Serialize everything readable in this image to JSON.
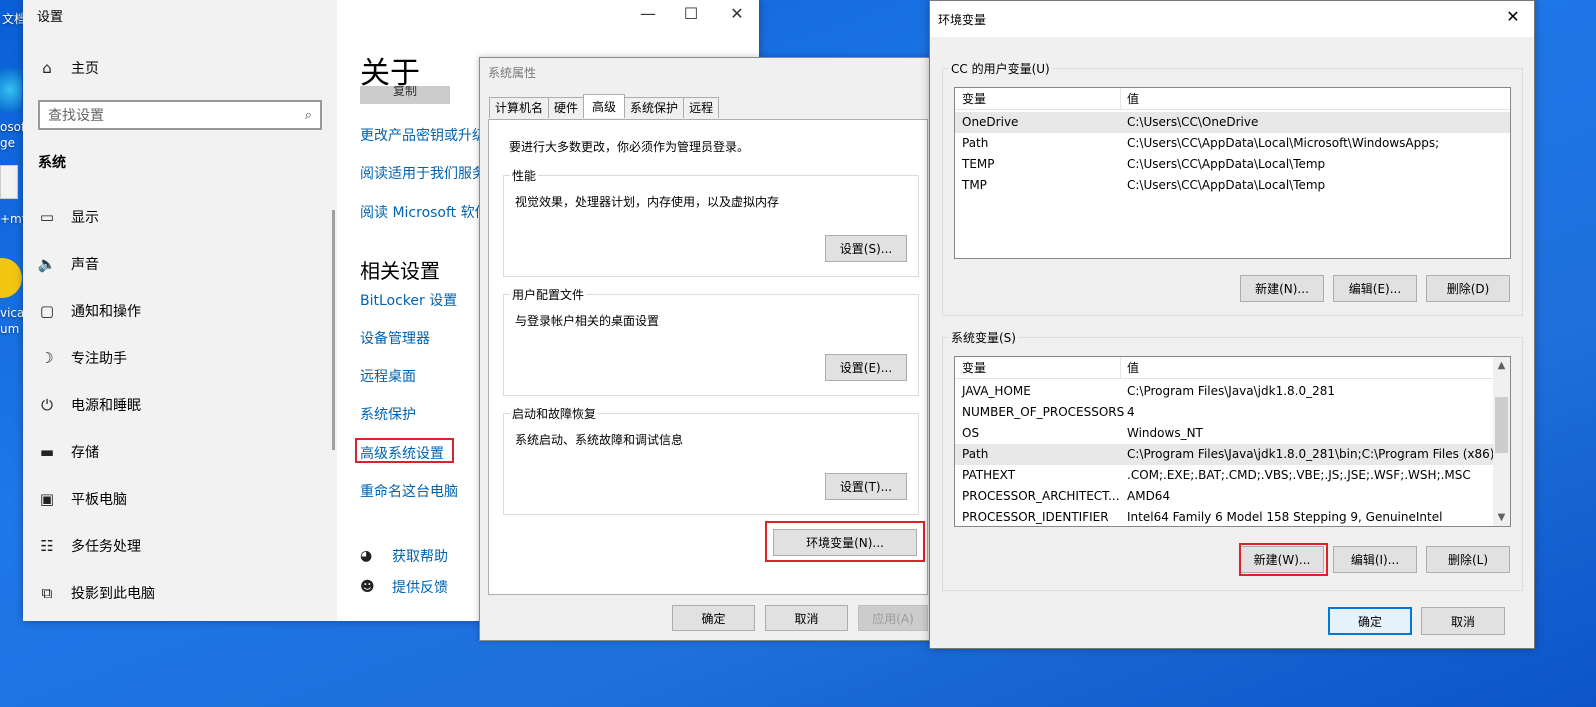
{
  "desktop": {
    "fragments": [
      "文档",
      "osoft",
      "ge",
      "+my",
      "vicat",
      "um"
    ]
  },
  "settings": {
    "window_title": "设置",
    "controls": {
      "minimize": "—",
      "maximize": "☐",
      "close": "✕"
    },
    "home": "主页",
    "search_placeholder": "查找设置",
    "section": "系统",
    "nav": [
      {
        "label": "显示",
        "icon": "monitor-icon"
      },
      {
        "label": "声音",
        "icon": "speaker-icon"
      },
      {
        "label": "通知和操作",
        "icon": "notification-icon"
      },
      {
        "label": "专注助手",
        "icon": "moon-icon"
      },
      {
        "label": "电源和睡眠",
        "icon": "power-icon"
      },
      {
        "label": "存储",
        "icon": "storage-icon"
      },
      {
        "label": "平板电脑",
        "icon": "tablet-icon"
      },
      {
        "label": "多任务处理",
        "icon": "multitask-icon"
      },
      {
        "label": "投影到此电脑",
        "icon": "project-icon"
      }
    ],
    "about_title": "关于",
    "copy_button": "复制",
    "about_links": [
      "更改产品密钥或升级",
      "阅读适用于我们服务",
      "阅读 Microsoft 软件"
    ],
    "related_title": "相关设置",
    "related_links": [
      "BitLocker 设置",
      "设备管理器",
      "远程桌面",
      "系统保护",
      "高级系统设置",
      "重命名这台电脑"
    ],
    "help": "获取帮助",
    "feedback": "提供反馈"
  },
  "sysprop": {
    "title": "系统属性",
    "tabs": [
      "计算机名",
      "硬件",
      "高级",
      "系统保护",
      "远程"
    ],
    "active_tab": "高级",
    "admin_note": "要进行大多数更改，你必须作为管理员登录。",
    "groups": [
      {
        "label": "性能",
        "desc": "视觉效果，处理器计划，内存使用，以及虚拟内存",
        "button": "设置(S)..."
      },
      {
        "label": "用户配置文件",
        "desc": "与登录帐户相关的桌面设置",
        "button": "设置(E)..."
      },
      {
        "label": "启动和故障恢复",
        "desc": "系统启动、系统故障和调试信息",
        "button": "设置(T)..."
      }
    ],
    "env_button": "环境变量(N)...",
    "ok": "确定",
    "cancel": "取消",
    "apply": "应用(A)"
  },
  "envvars": {
    "title": "环境变量",
    "close": "✕",
    "user_section": "CC 的用户变量(U)",
    "col_var": "变量",
    "col_val": "值",
    "user_rows": [
      {
        "name": "OneDrive",
        "value": "C:\\Users\\CC\\OneDrive"
      },
      {
        "name": "Path",
        "value": "C:\\Users\\CC\\AppData\\Local\\Microsoft\\WindowsApps;"
      },
      {
        "name": "TEMP",
        "value": "C:\\Users\\CC\\AppData\\Local\\Temp"
      },
      {
        "name": "TMP",
        "value": "C:\\Users\\CC\\AppData\\Local\\Temp"
      }
    ],
    "user_buttons": {
      "new": "新建(N)...",
      "edit": "编辑(E)...",
      "delete": "删除(D)"
    },
    "system_section": "系统变量(S)",
    "system_rows": [
      {
        "name": "JAVA_HOME",
        "value": "C:\\Program Files\\Java\\jdk1.8.0_281"
      },
      {
        "name": "NUMBER_OF_PROCESSORS",
        "value": "4"
      },
      {
        "name": "OS",
        "value": "Windows_NT"
      },
      {
        "name": "Path",
        "value": "C:\\Program Files\\Java\\jdk1.8.0_281\\bin;C:\\Program Files (x86)..."
      },
      {
        "name": "PATHEXT",
        "value": ".COM;.EXE;.BAT;.CMD;.VBS;.VBE;.JS;.JSE;.WSF;.WSH;.MSC"
      },
      {
        "name": "PROCESSOR_ARCHITECT...",
        "value": "AMD64"
      },
      {
        "name": "PROCESSOR_IDENTIFIER",
        "value": "Intel64 Family 6 Model 158 Stepping 9, GenuineIntel"
      }
    ],
    "system_buttons": {
      "new": "新建(W)...",
      "edit": "编辑(I)...",
      "delete": "删除(L)"
    },
    "ok": "确定",
    "cancel": "取消"
  },
  "colors": {
    "highlight": "#e0202a",
    "link": "#0063b1",
    "accent": "#0078d7"
  }
}
